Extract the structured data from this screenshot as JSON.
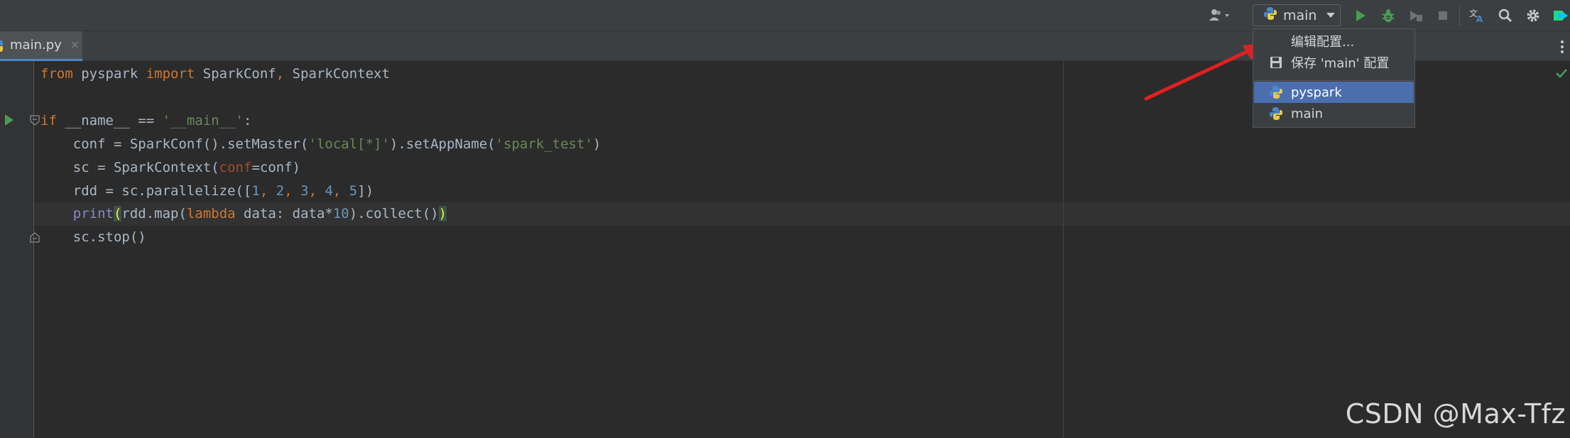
{
  "toolbar": {
    "run_config_label": "main",
    "icons": [
      "user-icon",
      "run-icon",
      "debug-icon",
      "coverage-icon",
      "stop-icon",
      "translate-icon",
      "search-icon",
      "gear-icon",
      "plugin-icon"
    ]
  },
  "tabs": [
    {
      "label": "main.py",
      "active": true
    }
  ],
  "code_lines": [
    "from pyspark import SparkConf, SparkContext",
    "",
    "if __name__ == '__main__':",
    "    conf = SparkConf().setMaster('local[*]').setAppName('spark_test')",
    "    sc = SparkContext(conf=conf)",
    "    rdd = sc.parallelize([1, 2, 3, 4, 5])",
    "    print(rdd.map(lambda data: data*10).collect())",
    "    sc.stop()"
  ],
  "code_tokens": {
    "l1_from": "from",
    "l1_mod": " pyspark ",
    "l1_import": "import",
    "l1_rest1": " SparkConf",
    "l1_comma": ",",
    "l1_rest2": " SparkContext",
    "l3_if": "if",
    "l3_rest": " __name__ == ",
    "l3_str": "'__main__'",
    "l3_colon": ":",
    "l4_a": "    conf = SparkConf().setMaster(",
    "l4_s1": "'local[*]'",
    "l4_b": ").setAppName(",
    "l4_s2": "'spark_test'",
    "l4_c": ")",
    "l5_a": "    sc = SparkContext(",
    "l5_p": "conf",
    "l5_b": "=conf)",
    "l6_a": "    rdd = sc.parallelize([",
    "l6_n1": "1",
    "l6_c1": ", ",
    "l6_n2": "2",
    "l6_c2": ", ",
    "l6_n3": "3",
    "l6_c3": ", ",
    "l6_n4": "4",
    "l6_c4": ", ",
    "l6_n5": "5",
    "l6_b": "])",
    "l7_indent": "    ",
    "l7_print": "print",
    "l7_open": "(",
    "l7_a": "rdd.map(",
    "l7_lambda": "lambda",
    "l7_b": " data: data*",
    "l7_n": "10",
    "l7_c": ").collect()",
    "l7_close": ")",
    "l8": "    sc.stop()"
  },
  "dropdown": {
    "items": [
      {
        "label": "编辑配置...",
        "icon": ""
      },
      {
        "label": "保存 'main' 配置",
        "icon": "save-icon"
      },
      {
        "label": "pyspark",
        "icon": "python-icon",
        "selected": true
      },
      {
        "label": "main",
        "icon": "python-icon",
        "selected": false
      }
    ]
  },
  "watermark": "CSDN @Max-Tfz",
  "colors": {
    "keyword": "#cc7832",
    "string": "#6a8759",
    "number": "#6897bb",
    "selection": "#4b6eaf",
    "run_green": "#499c54",
    "arrow_red": "#e02020"
  }
}
